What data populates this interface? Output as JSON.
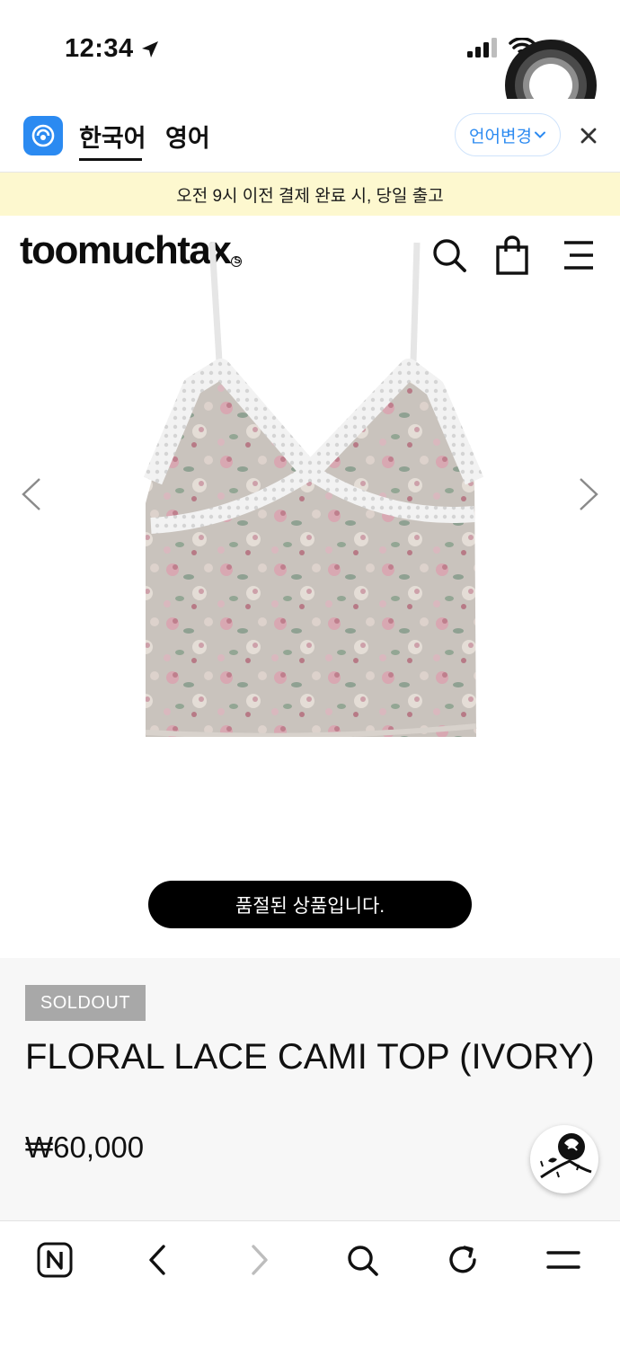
{
  "status_bar": {
    "time": "12:34",
    "location_icon": "location-arrow-icon",
    "signal_icon": "cellular-signal-icon",
    "wifi_icon": "wifi-icon",
    "battery_icon": "battery-icon"
  },
  "translate_bar": {
    "active_language": "한국어",
    "other_language": "영어",
    "change_label": "언어변경",
    "accent_color": "#2b8af1"
  },
  "notice": {
    "text": "오전 9시 이전 결제 완료 시, 당일 출고",
    "background": "#fdf8cf"
  },
  "header": {
    "brand": "toomuchtax",
    "brand_mark": "S"
  },
  "product": {
    "soldout_message": "품절된 상품입니다.",
    "badge": "SOLDOUT",
    "name": "FLORAL LACE CAMI TOP (IVORY)",
    "price": "₩60,000"
  },
  "browser_bar": {
    "buttons": [
      "naver-home-icon",
      "back-icon",
      "forward-icon",
      "search-icon",
      "reload-icon",
      "menu-icon"
    ]
  }
}
